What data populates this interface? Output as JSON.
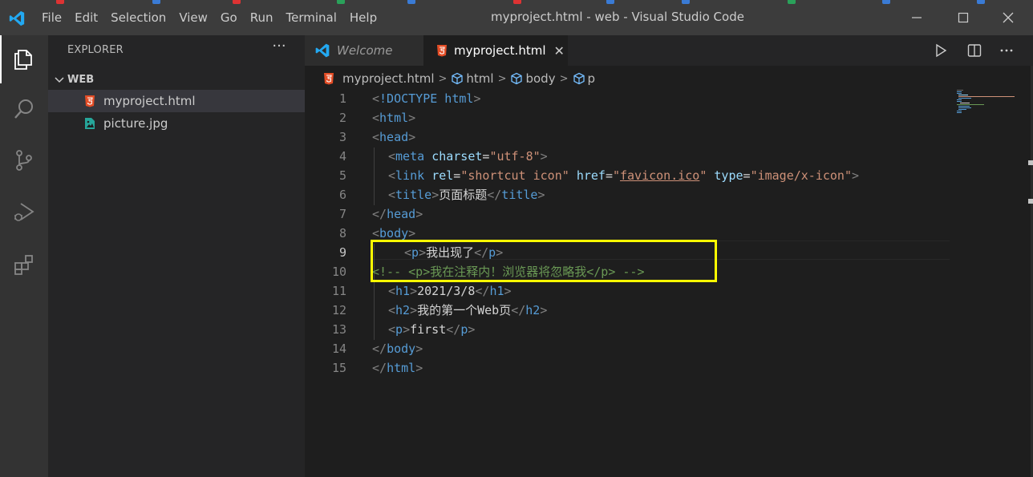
{
  "window": {
    "title": "myproject.html - web - Visual Studio Code"
  },
  "menubar": {
    "items": [
      "File",
      "Edit",
      "Selection",
      "View",
      "Go",
      "Run",
      "Terminal",
      "Help"
    ]
  },
  "activitybar": {
    "items": [
      {
        "name": "explorer",
        "icon": "files-icon",
        "active": true
      },
      {
        "name": "search",
        "icon": "search-icon",
        "active": false
      },
      {
        "name": "source-control",
        "icon": "source-control-icon",
        "active": false
      },
      {
        "name": "run-debug",
        "icon": "run-debug-icon",
        "active": false
      },
      {
        "name": "extensions",
        "icon": "extensions-icon",
        "active": false
      }
    ]
  },
  "sidebar": {
    "title": "EXPLORER",
    "more_label": "···",
    "folder": "WEB",
    "files": [
      {
        "name": "myproject.html",
        "icon": "html-file-icon",
        "selected": true
      },
      {
        "name": "picture.jpg",
        "icon": "image-file-icon",
        "selected": false
      }
    ]
  },
  "tabs": [
    {
      "label": "Welcome",
      "icon": "vscode-icon",
      "active": false
    },
    {
      "label": "myproject.html",
      "icon": "html-file-icon",
      "active": true,
      "close": "✕"
    }
  ],
  "breadcrumb": [
    "myproject.html",
    "html",
    "body",
    "p"
  ],
  "editor": {
    "lines": [
      {
        "num": "1",
        "text": "<!DOCTYPE html>"
      },
      {
        "num": "2",
        "text": "<html>"
      },
      {
        "num": "3",
        "text": "<head>"
      },
      {
        "num": "4",
        "text": "<meta charset=\"utf-8\">"
      },
      {
        "num": "5",
        "text": "<link rel=\"shortcut icon\" href=\"favicon.ico\" type=\"image/x-icon\">"
      },
      {
        "num": "6",
        "text": "<title>页面标题</title>"
      },
      {
        "num": "7",
        "text": "</head>"
      },
      {
        "num": "8",
        "text": "<body>"
      },
      {
        "num": "9",
        "text": "<p>我出现了</p>"
      },
      {
        "num": "10",
        "text": "<!-- <p>我在注释内！浏览器将忽略我</p> -->"
      },
      {
        "num": "11",
        "text": "<h1>2021/3/8</h1>"
      },
      {
        "num": "12",
        "text": "<h2>我的第一个Web页</h2>"
      },
      {
        "num": "13",
        "text": "<p>first</p>"
      },
      {
        "num": "14",
        "text": "</body>"
      },
      {
        "num": "15",
        "text": "</html>"
      }
    ],
    "active_line": "9"
  },
  "colors": {
    "highlight_box": "#ffff00",
    "html_icon": "#e44d26",
    "image_icon": "#26a69a",
    "vscode_blue": "#23a9f2"
  }
}
